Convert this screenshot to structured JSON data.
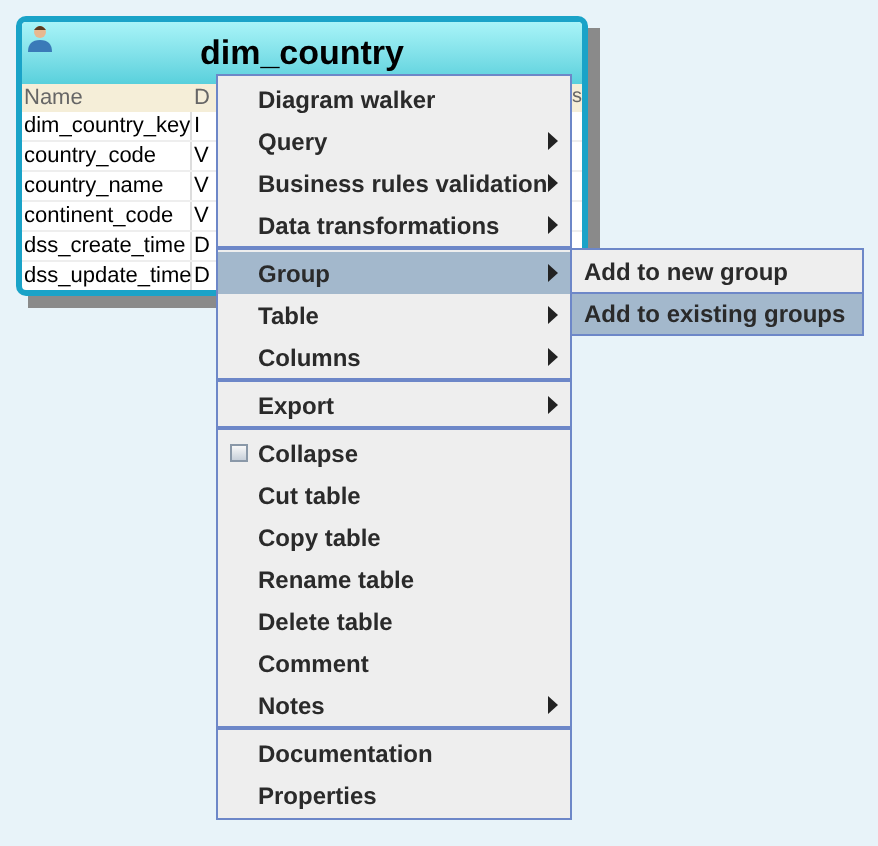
{
  "table": {
    "title": "dim_country",
    "columns": [
      "Name",
      "D",
      "s"
    ],
    "rows": [
      [
        "dim_country_key",
        "I"
      ],
      [
        "country_code",
        "V"
      ],
      [
        "country_name",
        "V"
      ],
      [
        "continent_code",
        "V"
      ],
      [
        "dss_create_time",
        "D"
      ],
      [
        "dss_update_time",
        "D"
      ]
    ]
  },
  "context_menu": {
    "sections": [
      [
        {
          "label": "Diagram walker",
          "kind": "action",
          "submenu": false,
          "selected": false
        },
        {
          "label": "Query",
          "kind": "action",
          "submenu": true,
          "selected": false
        },
        {
          "label": "Business rules validation",
          "kind": "action",
          "submenu": true,
          "selected": false
        },
        {
          "label": "Data transformations",
          "kind": "action",
          "submenu": true,
          "selected": false
        }
      ],
      [
        {
          "label": "Group",
          "kind": "action",
          "submenu": true,
          "selected": true
        },
        {
          "label": "Table",
          "kind": "action",
          "submenu": true,
          "selected": false
        },
        {
          "label": "Columns",
          "kind": "action",
          "submenu": true,
          "selected": false
        }
      ],
      [
        {
          "label": "Export",
          "kind": "action",
          "submenu": true,
          "selected": false
        }
      ],
      [
        {
          "label": "Collapse",
          "kind": "checkbox",
          "checked": false,
          "submenu": false,
          "selected": false
        },
        {
          "label": "Cut table",
          "kind": "action",
          "submenu": false,
          "selected": false
        },
        {
          "label": "Copy table",
          "kind": "action",
          "submenu": false,
          "selected": false
        },
        {
          "label": "Rename table",
          "kind": "action",
          "submenu": false,
          "selected": false
        },
        {
          "label": "Delete table",
          "kind": "action",
          "submenu": false,
          "selected": false
        },
        {
          "label": "Comment",
          "kind": "action",
          "submenu": false,
          "selected": false
        },
        {
          "label": "Notes",
          "kind": "action",
          "submenu": true,
          "selected": false
        }
      ],
      [
        {
          "label": "Documentation",
          "kind": "action",
          "submenu": false,
          "selected": false
        },
        {
          "label": "Properties",
          "kind": "action",
          "submenu": false,
          "selected": false
        }
      ]
    ]
  },
  "submenu": {
    "items": [
      {
        "label": "Add to new group",
        "selected": false
      },
      {
        "label": "Add to existing groups",
        "selected": true
      }
    ]
  }
}
